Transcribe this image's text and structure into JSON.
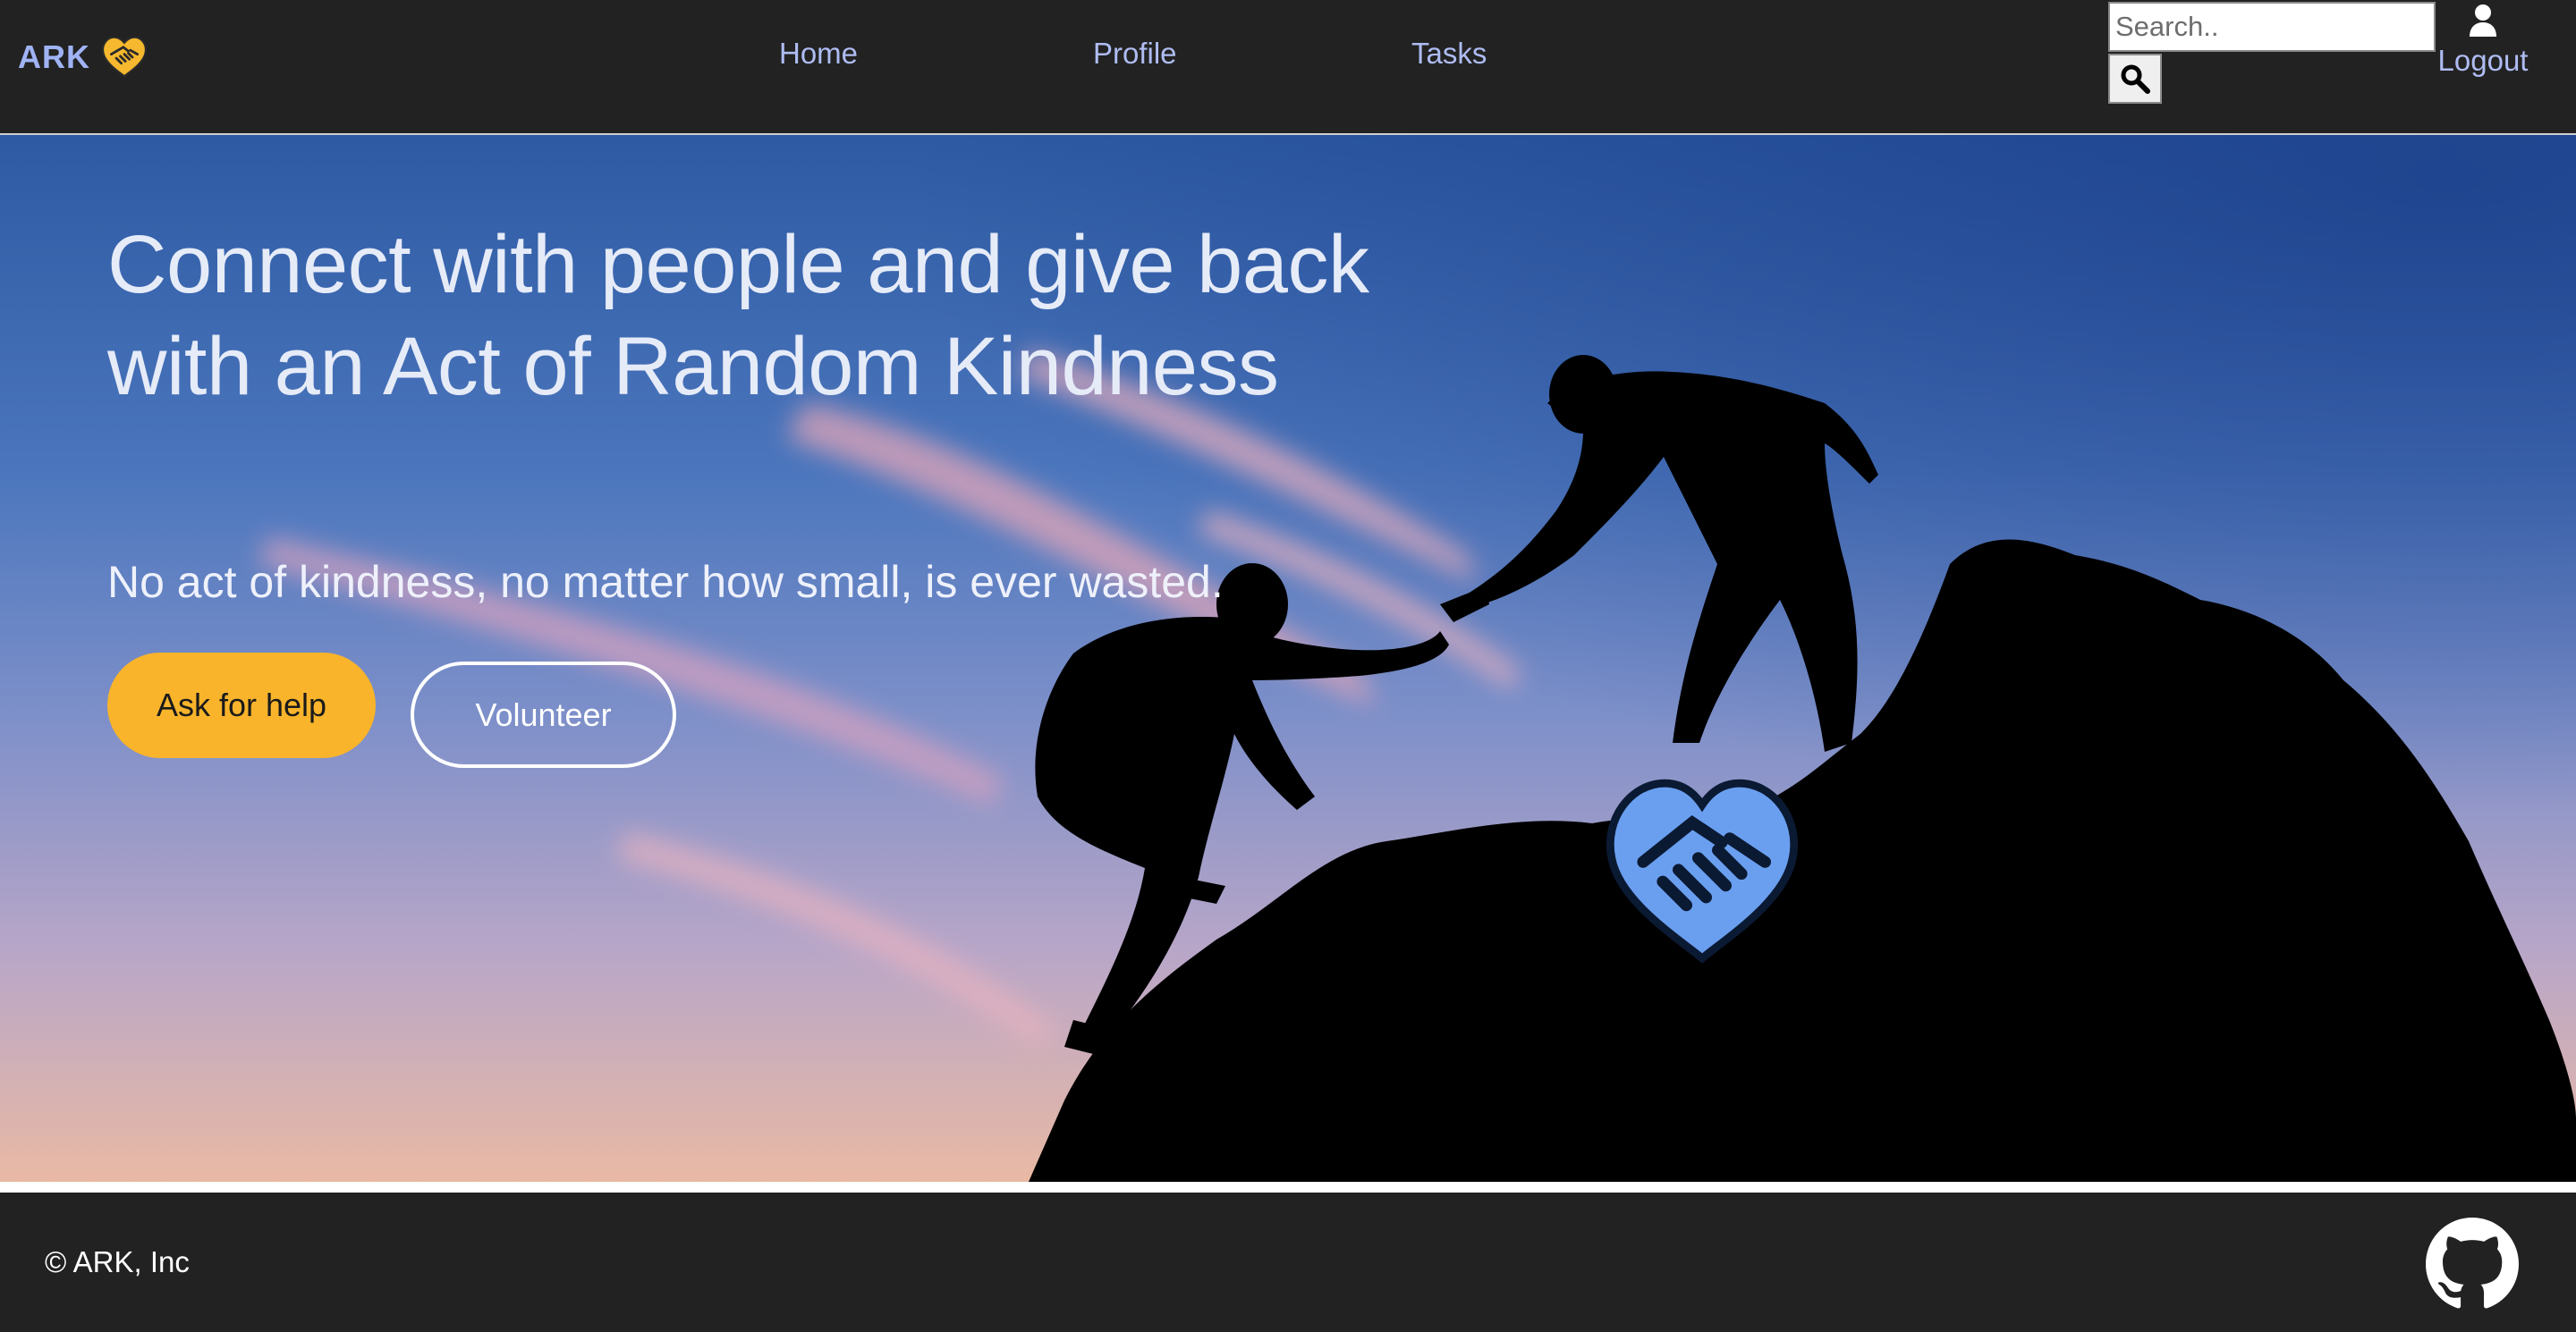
{
  "brand": {
    "name": "ARK",
    "icon": "handshake-heart-icon",
    "icon_color": "#f5b82e",
    "text_color": "#9fb3f5"
  },
  "nav": {
    "links": [
      {
        "label": "Home"
      },
      {
        "label": "Profile"
      },
      {
        "label": "Tasks"
      }
    ],
    "search": {
      "placeholder": "Search..",
      "value": "",
      "button_icon": "search-icon"
    },
    "user": {
      "icon": "user-icon",
      "logout_label": "Logout"
    },
    "background": "#222222",
    "link_color": "#aebcf2"
  },
  "hero": {
    "title": "Connect with people and give back with an Act of Random Kindness",
    "subtitle": "No act of kindness, no matter how small, is ever wasted.",
    "primary_button": {
      "label": "Ask for help",
      "color": "#f9b42b"
    },
    "secondary_button": {
      "label": "Volunteer"
    },
    "background_image": "silhouettes-helping-hand-mountain-sunset",
    "center_logo": {
      "icon": "handshake-heart-icon",
      "color": "#6a9ff0"
    }
  },
  "footer": {
    "copyright": "© ARK, Inc",
    "github_icon": "github-icon",
    "background": "#222222"
  }
}
